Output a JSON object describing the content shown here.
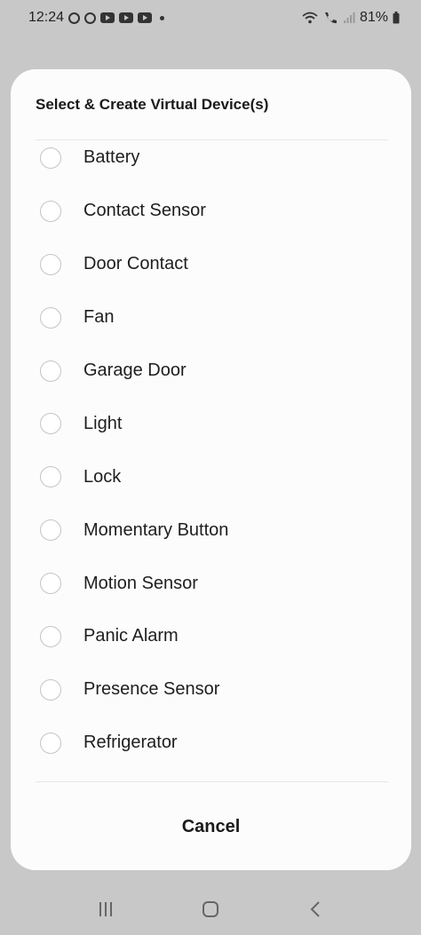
{
  "status_bar": {
    "time": "12:24",
    "battery": "81%"
  },
  "dialog": {
    "title": "Select & Create Virtual Device(s)",
    "options": [
      "Battery",
      "Contact Sensor",
      "Door Contact",
      "Fan",
      "Garage Door",
      "Light",
      "Lock",
      "Momentary Button",
      "Motion Sensor",
      "Panic Alarm",
      "Presence Sensor",
      "Refrigerator"
    ],
    "cancel_label": "Cancel"
  }
}
